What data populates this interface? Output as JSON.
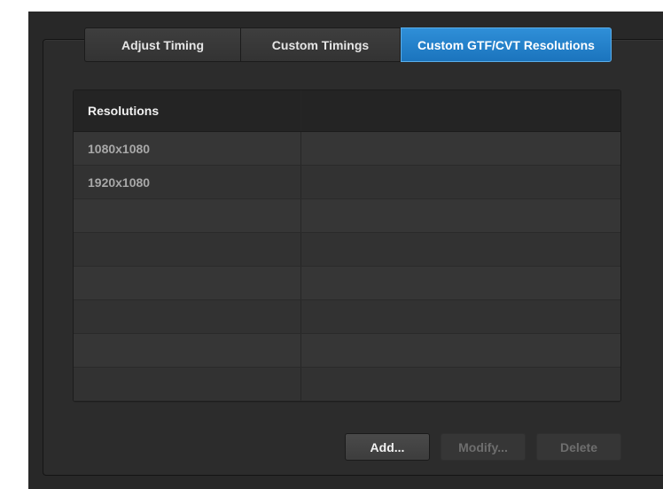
{
  "tabs": [
    {
      "label": "Adjust Timing",
      "active": false
    },
    {
      "label": "Custom Timings",
      "active": false
    },
    {
      "label": "Custom GTF/CVT Resolutions",
      "active": true
    }
  ],
  "table": {
    "header": {
      "col1": "Resolutions",
      "col2": ""
    },
    "rows": [
      {
        "col1": "1080x1080",
        "col2": ""
      },
      {
        "col1": "1920x1080",
        "col2": ""
      },
      {
        "col1": "",
        "col2": ""
      },
      {
        "col1": "",
        "col2": ""
      },
      {
        "col1": "",
        "col2": ""
      },
      {
        "col1": "",
        "col2": ""
      },
      {
        "col1": "",
        "col2": ""
      },
      {
        "col1": "",
        "col2": ""
      }
    ]
  },
  "buttons": {
    "add": "Add...",
    "modify": "Modify...",
    "delete": "Delete"
  },
  "colors": {
    "accent": "#1b74bd",
    "background": "#2c2c2c",
    "header": "#242424"
  }
}
